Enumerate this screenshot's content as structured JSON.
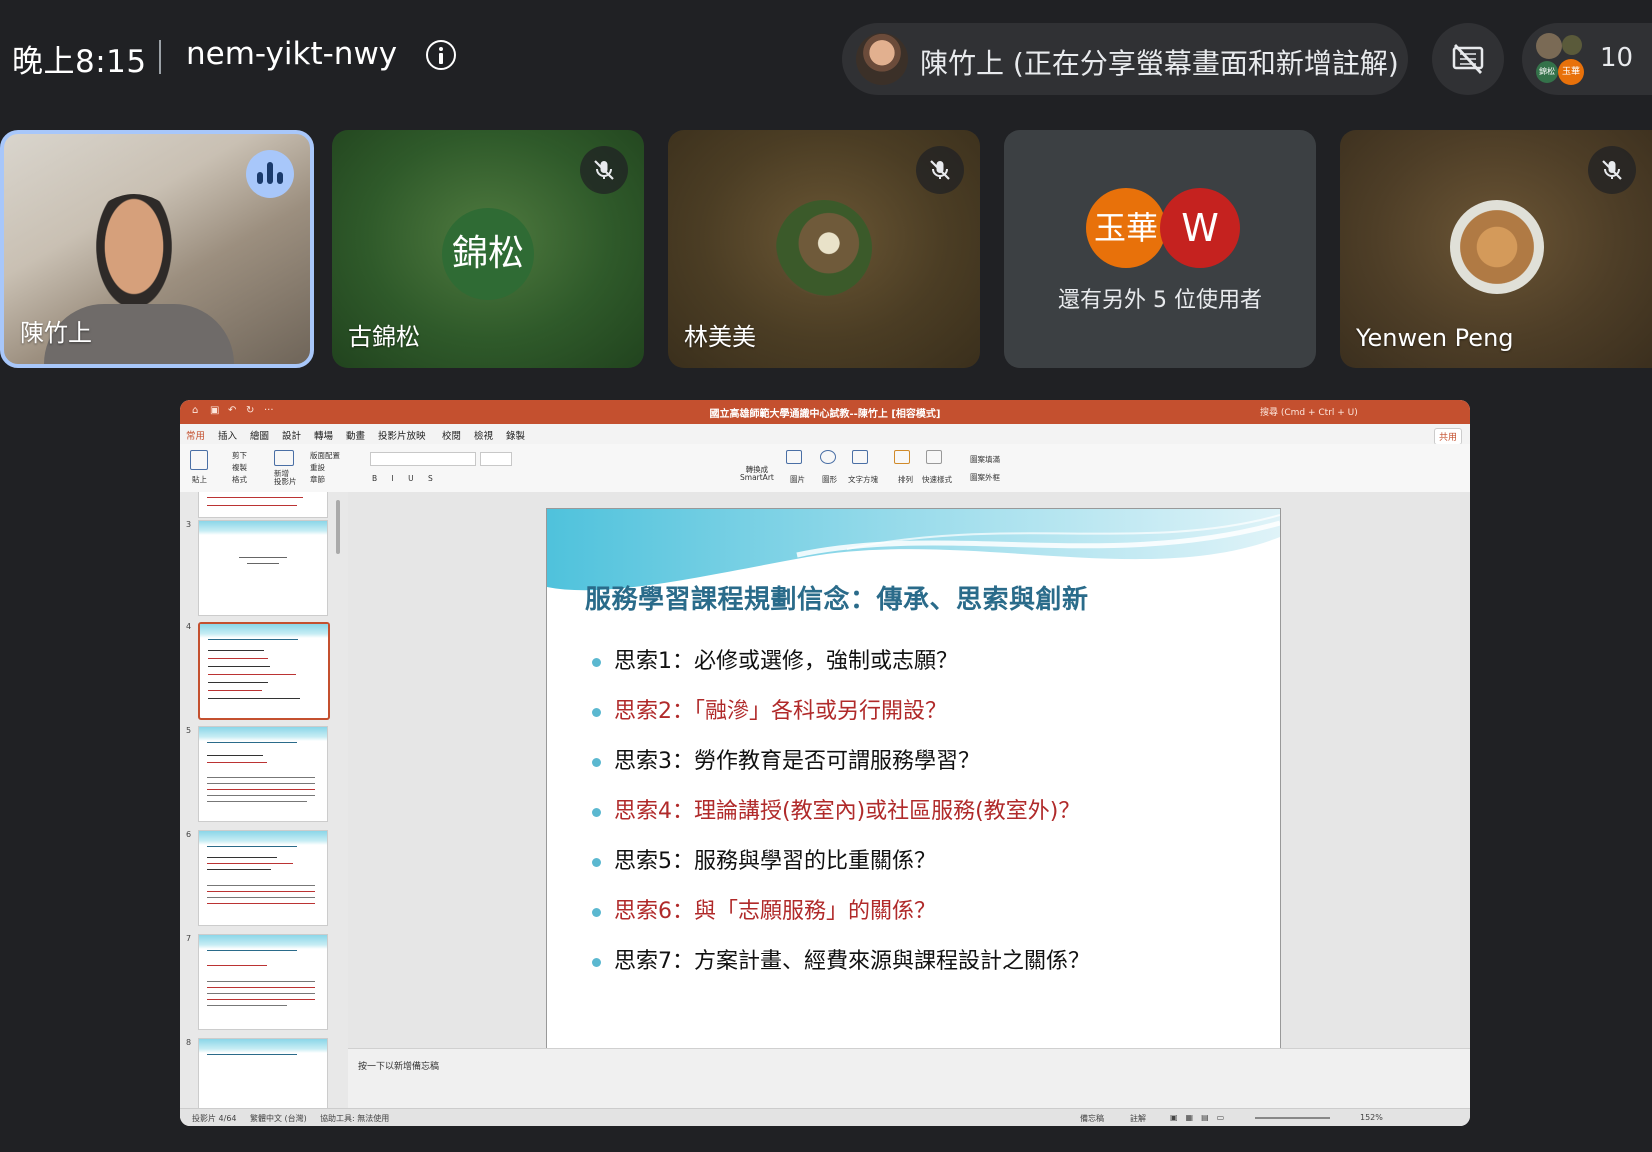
{
  "topbar": {
    "time": "晚上8:15",
    "meeting_code": "nem-yikt-nwy",
    "presenter_status": "陳竹上 (正在分享螢幕畫面和新增註解)",
    "participant_count": "10",
    "mini_avatars": [
      "錦松",
      "玉華"
    ]
  },
  "tiles": [
    {
      "name": "陳竹上",
      "state": "speaking"
    },
    {
      "name": "古錦松",
      "avatar_text": "錦松",
      "state": "muted"
    },
    {
      "name": "林美美",
      "state": "muted"
    },
    {
      "others_text": "還有另外 5 位使用者",
      "avatars": [
        "玉華",
        "W"
      ],
      "colors": [
        "#e8710a",
        "#c5221f"
      ]
    },
    {
      "name": "Yenwen Peng",
      "state": "muted"
    }
  ],
  "ppt": {
    "window_title": "國立高雄師範大學通識中心試教--陳竹上 [相容模式]",
    "search_placeholder": "搜尋 (Cmd + Ctrl + U)",
    "share_label": "共用",
    "tabs": [
      "常用",
      "插入",
      "繪圖",
      "設計",
      "轉場",
      "動畫",
      "投影片放映",
      "校閱",
      "檢視",
      "錄製"
    ],
    "ribbon": {
      "paste": "貼上",
      "cut": "剪下",
      "copy": "複製",
      "format": "格式",
      "new_slide": "新增\n投影片",
      "layout": "版面配置",
      "reset": "重設",
      "section": "章節",
      "convert_smartart": "轉換成\nSmartArt",
      "picture": "圖片",
      "shapes": "圖形",
      "textbox": "文字方塊",
      "arrange": "排列",
      "quick_styles": "快速樣式",
      "shape_fill": "圖案填滿",
      "shape_outline": "圖案外框"
    },
    "thumbnail_numbers": [
      "3",
      "4",
      "5",
      "6",
      "7",
      "8"
    ],
    "notes_placeholder": "按一下以新增備忘稿",
    "status": {
      "slide_position": "投影片 4/64",
      "language": "繁體中文 (台灣)",
      "accessibility": "協助工具: 無法使用",
      "notes_btn": "備忘稿",
      "comments_btn": "註解",
      "zoom": "152%"
    }
  },
  "slide": {
    "title": "服務學習課程規劃信念：傳承、思索與創新",
    "bullets": [
      {
        "text": "思索1：必修或選修，強制或志願？",
        "color": "black"
      },
      {
        "text": "思索2：「融滲」各科或另行開設？",
        "color": "red"
      },
      {
        "text": "思索3：勞作教育是否可謂服務學習？",
        "color": "black"
      },
      {
        "text": "思索4：理論講授(教室內)或社區服務(教室外)？",
        "color": "red"
      },
      {
        "text": "思索5：服務與學習的比重關係？",
        "color": "black"
      },
      {
        "text": "思索6：與「志願服務」的關係？",
        "color": "red"
      },
      {
        "text": "思索7：方案計畫、經費來源與課程設計之關係？",
        "color": "black"
      }
    ]
  }
}
